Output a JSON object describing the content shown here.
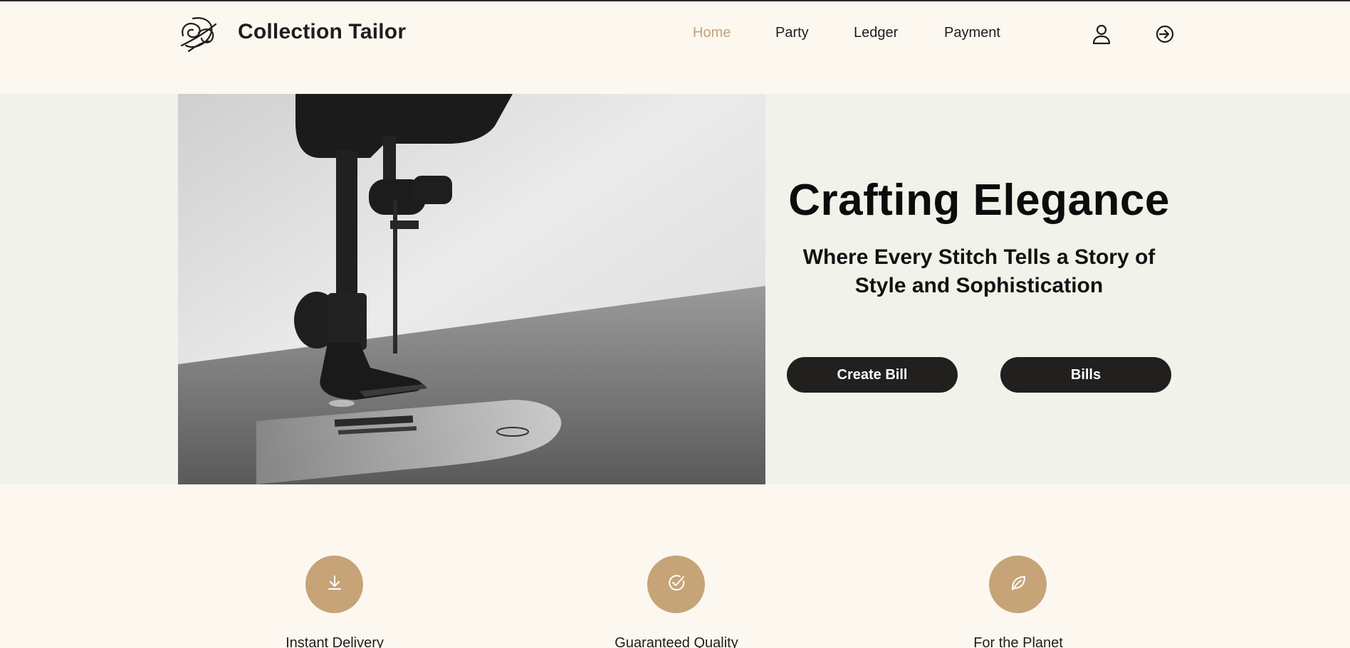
{
  "header": {
    "brand": "Collection Tailor",
    "nav": [
      {
        "label": "Home",
        "active": true
      },
      {
        "label": "Party",
        "active": false
      },
      {
        "label": "Ledger",
        "active": false
      },
      {
        "label": "Payment",
        "active": false
      }
    ],
    "icons": [
      "user-icon",
      "login-icon"
    ]
  },
  "hero": {
    "title": "Crafting Elegance",
    "subtitle": "Where Every Stitch Tells a Story of Style and Sophistication",
    "buttons": {
      "create_bill": "Create Bill",
      "bills": "Bills"
    },
    "image": "sewing-machine-photo"
  },
  "features": [
    {
      "icon": "download-icon",
      "label": "Instant Delivery"
    },
    {
      "icon": "check-circle-icon",
      "label": "Guaranteed Quality"
    },
    {
      "icon": "leaf-icon",
      "label": "For the Planet"
    }
  ],
  "colors": {
    "background": "#fcf8f0",
    "hero_background": "#f1f3ea",
    "accent": "#c6a478",
    "nav_active": "#c3a377",
    "button": "#221f1f"
  }
}
